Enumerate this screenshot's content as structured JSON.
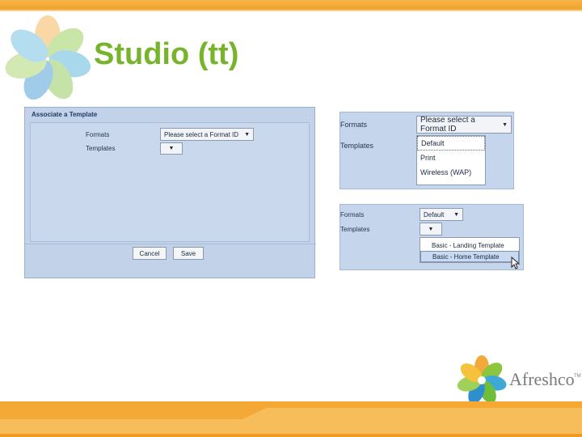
{
  "slide": {
    "title": "Studio (tt)"
  },
  "dialog": {
    "title": "Associate a Template",
    "formats_label": "Formats",
    "templates_label": "Templates",
    "formats_value": "Please select a Format ID",
    "cancel_label": "Cancel",
    "save_label": "Save"
  },
  "panel_formats": {
    "formats_label": "Formats",
    "templates_label": "Templates",
    "formats_value": "Please select a Format ID",
    "options": [
      "Default",
      "Print",
      "Wireless (WAP)"
    ]
  },
  "panel_templates": {
    "formats_label": "Formats",
    "templates_label": "Templates",
    "formats_value": "Default",
    "options": [
      "Basic - Landing Template",
      "Basic - Home Template"
    ]
  },
  "brand": {
    "name": "Afreshco",
    "tm": "TM"
  },
  "colors": {
    "accent_orange": "#f0a12c",
    "title_green": "#78b32c",
    "dialog_blue": "#c1d2e9"
  }
}
